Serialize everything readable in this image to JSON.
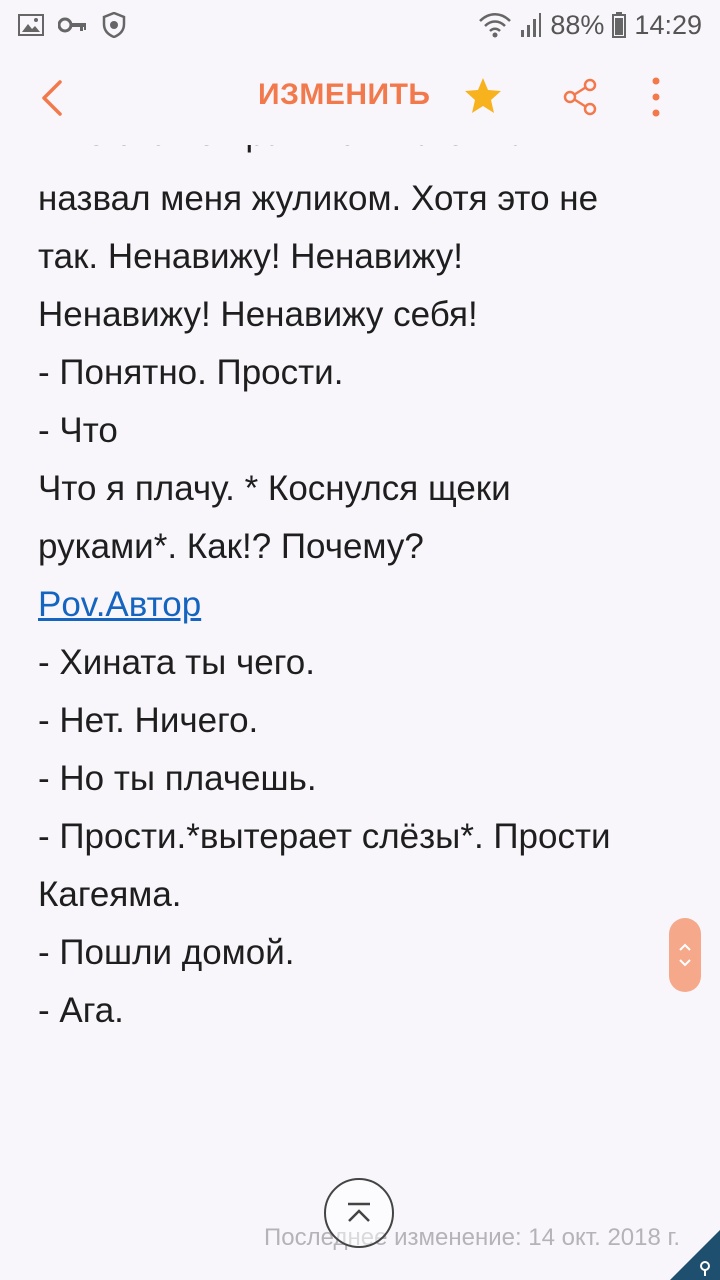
{
  "status_bar": {
    "battery": "88%",
    "time": "14:29",
    "icons": [
      "gallery-icon",
      "key-icon",
      "shield-icon",
      "wifi-icon",
      "signal-icon",
      "battery-icon"
    ]
  },
  "toolbar": {
    "title": "ИЗМЕНИТЬ",
    "accent": "#f2794c",
    "star_color": "#f7b21e"
  },
  "content": {
    "partial_top": "Мне это не нравится. Кагеяма",
    "lines": [
      "назвал меня жуликом. Хотя это не",
      "так. Ненавижу! Ненавижу!",
      "Ненавижу! Ненавижу себя!",
      "- Понятно. Прости.",
      "- Что",
      "Что я плачу. * Коснулся щеки",
      "руками*. Как!? Почему?"
    ],
    "link": "Pov.Автор",
    "lines_after": [
      "- Хината ты чего.",
      "- Нет. Ничего.",
      "- Но ты плачешь.",
      "- Прости.*вытерает слёзы*. Прости",
      "Кагеяма.",
      "- Пошли домой.",
      "- Ага."
    ]
  },
  "footer": {
    "last_modified": "Последнее изменение: 14 окт. 2018 г."
  }
}
